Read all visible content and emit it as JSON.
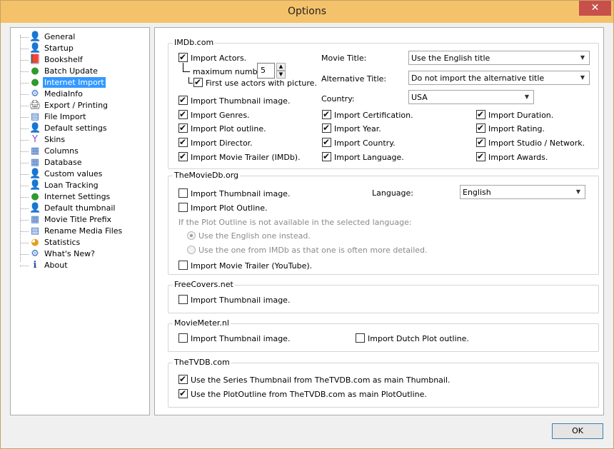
{
  "window": {
    "title": "Options"
  },
  "icons": {
    "close": "close-icon"
  },
  "tree": {
    "items": [
      {
        "label": "General",
        "icon": "user-icon",
        "glyph": "👤",
        "color": "#b06a2a"
      },
      {
        "label": "Startup",
        "icon": "user-icon",
        "glyph": "👤",
        "color": "#b06a2a"
      },
      {
        "label": "Bookshelf",
        "icon": "book-icon",
        "glyph": "📕",
        "color": "#6b3d1e"
      },
      {
        "label": "Batch Update",
        "icon": "globe-icon",
        "glyph": "●",
        "color": "#2e9b2e"
      },
      {
        "label": "Internet Import",
        "icon": "globe-icon",
        "glyph": "●",
        "color": "#2e9b2e"
      },
      {
        "label": "MediaInfo",
        "icon": "gear-icon",
        "glyph": "⚙",
        "color": "#3b6fc1"
      },
      {
        "label": "Export / Printing",
        "icon": "printer-icon",
        "glyph": "🖨",
        "color": "#555"
      },
      {
        "label": "File Import",
        "icon": "document-icon",
        "glyph": "▤",
        "color": "#3b6fc1"
      },
      {
        "label": "Default settings",
        "icon": "user-icon",
        "glyph": "👤",
        "color": "#b06a2a"
      },
      {
        "label": "Skins",
        "icon": "palette-icon",
        "glyph": "Y",
        "color": "#8a4fc1"
      },
      {
        "label": "Columns",
        "icon": "windows-icon",
        "glyph": "▦",
        "color": "#3b6fc1"
      },
      {
        "label": "Database",
        "icon": "windows-icon",
        "glyph": "▦",
        "color": "#3b6fc1"
      },
      {
        "label": "Custom values",
        "icon": "user-icon",
        "glyph": "👤",
        "color": "#b06a2a"
      },
      {
        "label": "Loan Tracking",
        "icon": "user-icon",
        "glyph": "👤",
        "color": "#b06a2a"
      },
      {
        "label": "Internet Settings",
        "icon": "globe-icon",
        "glyph": "●",
        "color": "#2e9b2e"
      },
      {
        "label": "Default thumbnail",
        "icon": "user-icon",
        "glyph": "👤",
        "color": "#b06a2a"
      },
      {
        "label": "Movie Title Prefix",
        "icon": "windows-icon",
        "glyph": "▦",
        "color": "#3b6fc1"
      },
      {
        "label": "Rename Media Files",
        "icon": "document-icon",
        "glyph": "▤",
        "color": "#3b6fc1"
      },
      {
        "label": "Statistics",
        "icon": "pie-chart-icon",
        "glyph": "◕",
        "color": "#e0a020"
      },
      {
        "label": "What's New?",
        "icon": "gear-icon",
        "glyph": "⚙",
        "color": "#3b6fc1"
      },
      {
        "label": "About",
        "icon": "info-icon",
        "glyph": "ℹ",
        "color": "#1f4f9e"
      }
    ],
    "selected": "Internet Import"
  },
  "imdb": {
    "title": "IMDb.com",
    "import_actors": "Import Actors.",
    "maximum_number": "maximum number",
    "max_value": "5",
    "first_use_actors": "First use actors with picture.",
    "import_thumbnail": "Import Thumbnail image.",
    "import_genres": "Import Genres.",
    "import_plot": "Import Plot outline.",
    "import_director": "Import Director.",
    "import_trailer": "Import Movie Trailer (IMDb).",
    "movie_title_label": "Movie Title:",
    "movie_title_value": "Use the English title",
    "alt_title_label": "Alternative Title:",
    "alt_title_value": "Do not import the alternative title",
    "country_label": "Country:",
    "country_value": "USA",
    "import_certification": "Import Certification.",
    "import_year": "Import Year.",
    "import_country": "Import Country.",
    "import_language": "Import Language.",
    "import_duration": "Import Duration.",
    "import_rating": "Import Rating.",
    "import_studio": "Import Studio / Network.",
    "import_awards": "Import Awards."
  },
  "tmdb": {
    "title": "TheMovieDb.org",
    "import_thumbnail": "Import Thumbnail image.",
    "import_plot": "Import Plot Outline.",
    "language_label": "Language:",
    "language_value": "English",
    "fallback_note": "If the Plot Outline is not available in the selected language:",
    "radio_english": "Use the English one instead.",
    "radio_imdb": "Use the one from IMDb as that one is often more detailed.",
    "import_trailer": "Import Movie Trailer (YouTube)."
  },
  "freecovers": {
    "title": "FreeCovers.net",
    "import_thumbnail": "Import Thumbnail image."
  },
  "moviemeter": {
    "title": "MovieMeter.nl",
    "import_thumbnail": "Import Thumbnail image.",
    "import_dutch_plot": "Import Dutch Plot outline."
  },
  "tvdb": {
    "title": "TheTVDB.com",
    "use_series_thumbnail": "Use the Series Thumbnail from TheTVDB.com as main Thumbnail.",
    "use_plot_outline": "Use the PlotOutline from TheTVDB.com as main PlotOutline."
  },
  "footer": {
    "ok_label": "OK"
  }
}
